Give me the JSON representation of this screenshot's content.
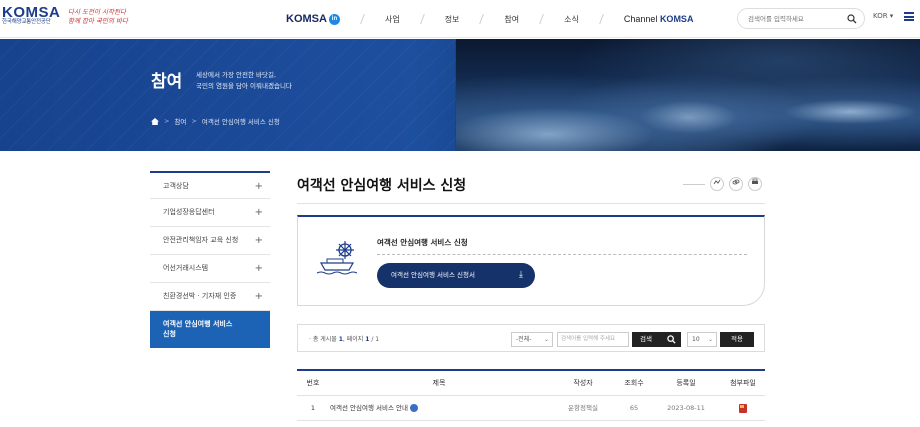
{
  "header": {
    "logo_text": "KOMSA",
    "logo_sub": "한국해양교통안전공단",
    "slogan_line1": "다시 도전이 시작된다",
    "slogan_line2": "함께 잡아 국민의 바다",
    "nav": [
      {
        "label": "KOMSA",
        "badge": "in"
      },
      {
        "label": "사업"
      },
      {
        "label": "정보"
      },
      {
        "label": "참여"
      },
      {
        "label": "소식"
      },
      {
        "label_prefix": "Channel",
        "label_strong": "KOMSA"
      }
    ],
    "search_placeholder": "검색어를 입력하세요",
    "lang": "KOR ▾"
  },
  "hero": {
    "title": "참여",
    "desc_line1": "세상에서 가장 안전한 바닷길,",
    "desc_line2": "국민의 염원을 담아 이뤄내겠습니다",
    "breadcrumb": [
      "참여",
      "여객선 안심여행 서비스 신청"
    ]
  },
  "sidebar": {
    "items": [
      {
        "label": "고객상담",
        "plus": "+"
      },
      {
        "label": "기업성장응답센터",
        "plus": "+"
      },
      {
        "label": "안전관리책임자 교육 신청",
        "plus": "+"
      },
      {
        "label": "어선거래시스템",
        "plus": "+"
      },
      {
        "label": "친환경선박 · 기자재 인증",
        "plus": "+"
      },
      {
        "label_line1": "여객선 안심여행 서비스",
        "label_line2": "신청"
      }
    ]
  },
  "page": {
    "title": "여객선 안심여행 서비스 신청",
    "tools": [
      "share-icon",
      "link-icon",
      "print-icon"
    ]
  },
  "card": {
    "title": "여객선 안심여행 서비스 신청",
    "download_label": "여객선 안심여행 서비스 신청서",
    "download_icon": "⤓"
  },
  "search_bar": {
    "count_prefix": "· 총 게시물",
    "count_total": "1",
    "count_mid": ", 페이지",
    "count_page": "1",
    "count_suffix": "/ 1",
    "field_select": "-전체-",
    "keyword_placeholder": "검색어를 입력해 주세요",
    "search_label": "검색",
    "page_size": "10",
    "apply_label": "적용"
  },
  "table": {
    "headers": [
      "번호",
      "제목",
      "작성자",
      "조회수",
      "등록일",
      "첨부파일"
    ],
    "rows": [
      {
        "no": "1",
        "title": "여객선 안심여행 서비스 안내",
        "author": "운항정책실",
        "views": "65",
        "date": "2023-08-11"
      }
    ]
  },
  "colors": {
    "brand": "#1d3c8a",
    "active": "#1d63b5",
    "button_dark": "#16326b"
  }
}
